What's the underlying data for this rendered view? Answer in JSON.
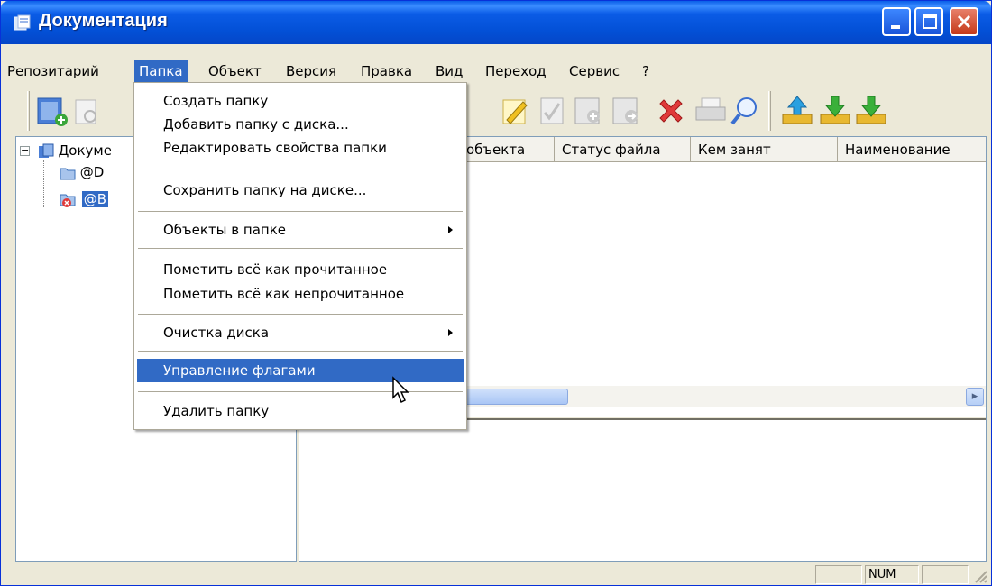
{
  "window": {
    "title": "Документация",
    "colors": {
      "titlebar": "#0554e3",
      "selection": "#316ac5",
      "close": "#c4391a"
    }
  },
  "menubar": {
    "items": [
      "Репозитарий",
      "Папка",
      "Объект",
      "Версия",
      "Правка",
      "Вид",
      "Переход",
      "Сервис",
      "?"
    ],
    "active": "Папка"
  },
  "toolbar": {
    "icons": [
      "new-folder-icon",
      "filter-icon",
      "edit-icon",
      "checkin-icon",
      "folder-add-icon",
      "folder-move-icon",
      "delete-icon",
      "print-icon",
      "search-icon",
      "upload-icon",
      "download-icon"
    ]
  },
  "tree": {
    "root_label": "Докуме",
    "items": [
      {
        "label": "@D",
        "icon": "folder-icon"
      },
      {
        "label": "@B",
        "icon": "folder-error-icon",
        "selected": true
      }
    ]
  },
  "list": {
    "columns": [
      "объекта",
      "Статус файла",
      "Кем занят",
      "Наименование"
    ]
  },
  "folder_menu": {
    "items": [
      {
        "label": "Создать папку"
      },
      {
        "label": "Добавить папку с диска..."
      },
      {
        "label": "Редактировать свойства папки"
      },
      {
        "label": "Сохранить папку на диске..."
      },
      {
        "label": "Объекты в папке",
        "submenu": true
      },
      {
        "label": "Пометить всё как прочитанное"
      },
      {
        "label": "Пометить всё как непрочитанное"
      },
      {
        "label": "Очистка диска",
        "submenu": true
      },
      {
        "label": "Управление флагами",
        "highlighted": true
      },
      {
        "label": "Удалить папку"
      }
    ]
  },
  "statusbar": {
    "num": "NUM"
  }
}
